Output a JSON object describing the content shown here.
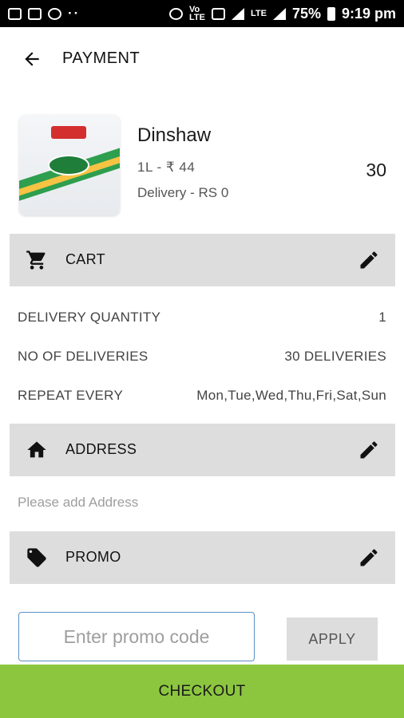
{
  "status_bar": {
    "left_icons": [
      "notification-icon",
      "image-icon",
      "app-icon",
      "more-dots-icon"
    ],
    "right_icons": [
      "alarm-icon",
      "volte-icon",
      "cast-icon",
      "signal-icon",
      "lte-signal-icon",
      "battery-icon"
    ],
    "volte_label": "Vo))\nLTE",
    "lte_label": "LTE",
    "battery": "75%",
    "time": "9:19 pm"
  },
  "header": {
    "title": "PAYMENT",
    "back_icon": "arrow-back-icon"
  },
  "product": {
    "name": "Dinshaw",
    "price_line": "1L  -  ₹ 44",
    "delivery_charge": "Delivery - RS 0",
    "quantity": "30"
  },
  "cart": {
    "label": "CART",
    "icon": "cart-icon",
    "edit_icon": "edit-pencil-icon",
    "rows": [
      {
        "label": "DELIVERY QUANTITY",
        "value": "1"
      },
      {
        "label": "NO OF DELIVERIES",
        "value": "30 DELIVERIES"
      },
      {
        "label": "REPEAT EVERY",
        "value": "Mon,Tue,Wed,Thu,Fri,Sat,Sun"
      }
    ]
  },
  "address": {
    "label": "ADDRESS",
    "icon": "home-icon",
    "edit_icon": "edit-pencil-icon",
    "placeholder_text": "Please add Address"
  },
  "promo": {
    "label": "PROMO",
    "icon": "tag-icon",
    "edit_icon": "edit-pencil-icon",
    "input_placeholder": "Enter promo code",
    "input_value": "",
    "apply_label": "APPLY"
  },
  "checkout": {
    "label": "CHECKOUT",
    "color": "#8cc63f"
  }
}
